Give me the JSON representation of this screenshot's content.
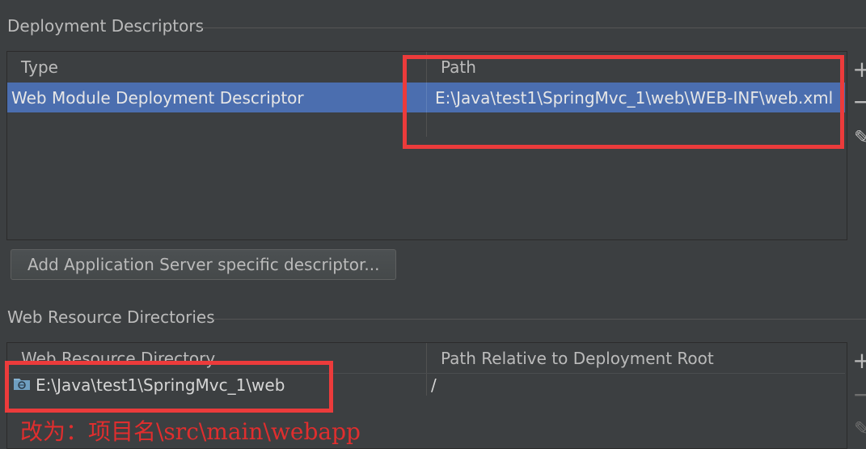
{
  "descriptors": {
    "section_title": "Deployment Descriptors",
    "columns": [
      "Type",
      "Path"
    ],
    "rows": [
      {
        "type": "Web Module Deployment Descriptor",
        "path": "E:\\Java\\test1\\SpringMvc_1\\web\\WEB-INF\\web.xml"
      }
    ],
    "add_button": "+",
    "remove_button": "−",
    "edit_button": "✎",
    "add_server_button": "Add Application Server specific descriptor..."
  },
  "resources": {
    "section_title": "Web Resource Directories",
    "columns": [
      "Web Resource Directory",
      "Path Relative to Deployment Root"
    ],
    "rows": [
      {
        "directory": "E:\\Java\\test1\\SpringMvc_1\\web",
        "relative_path": "/"
      }
    ],
    "add_button": "+",
    "remove_button": "−",
    "edit_button": "✎"
  },
  "annotation": {
    "text": "改为：项目名\\src\\main\\webapp"
  },
  "colors": {
    "background": "#3c3f41",
    "selection": "#4b6eaf",
    "highlight": "#ec3b3b",
    "annotation": "#e02e2e"
  },
  "icons": {
    "folder": "web-folder-icon"
  }
}
